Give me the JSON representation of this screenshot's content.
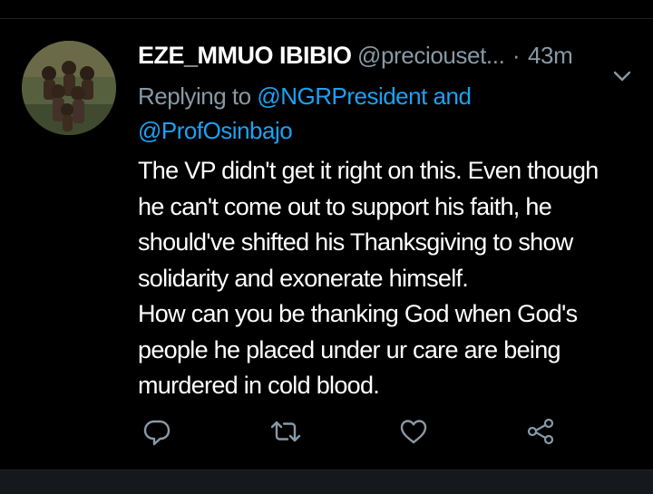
{
  "tweet": {
    "display_name": "EZE_MMUO IBIBIO",
    "handle": "@preciouset...",
    "separator": "·",
    "time": "43m",
    "replying_prefix": "Replying to ",
    "mention_1": "@NGRPresident",
    "replying_and": " and",
    "mention_2": "@ProfOsinbajo",
    "body_lines": [
      "The VP didn't get it right on this. Even though",
      "he can't come out to support his faith, he",
      "should've shifted his Thanksgiving to show",
      "solidarity and exonerate himself.",
      "How can you be thanking God when God's",
      "people he placed under ur care are being",
      "murdered in cold blood."
    ]
  },
  "actions": {
    "reply_icon": "reply-icon",
    "retweet_icon": "retweet-icon",
    "like_icon": "like-icon",
    "share_icon": "share-icon"
  },
  "colors": {
    "background": "#000000",
    "text": "#ffffff",
    "secondary_text": "#8899a6",
    "link": "#1da1f2"
  }
}
